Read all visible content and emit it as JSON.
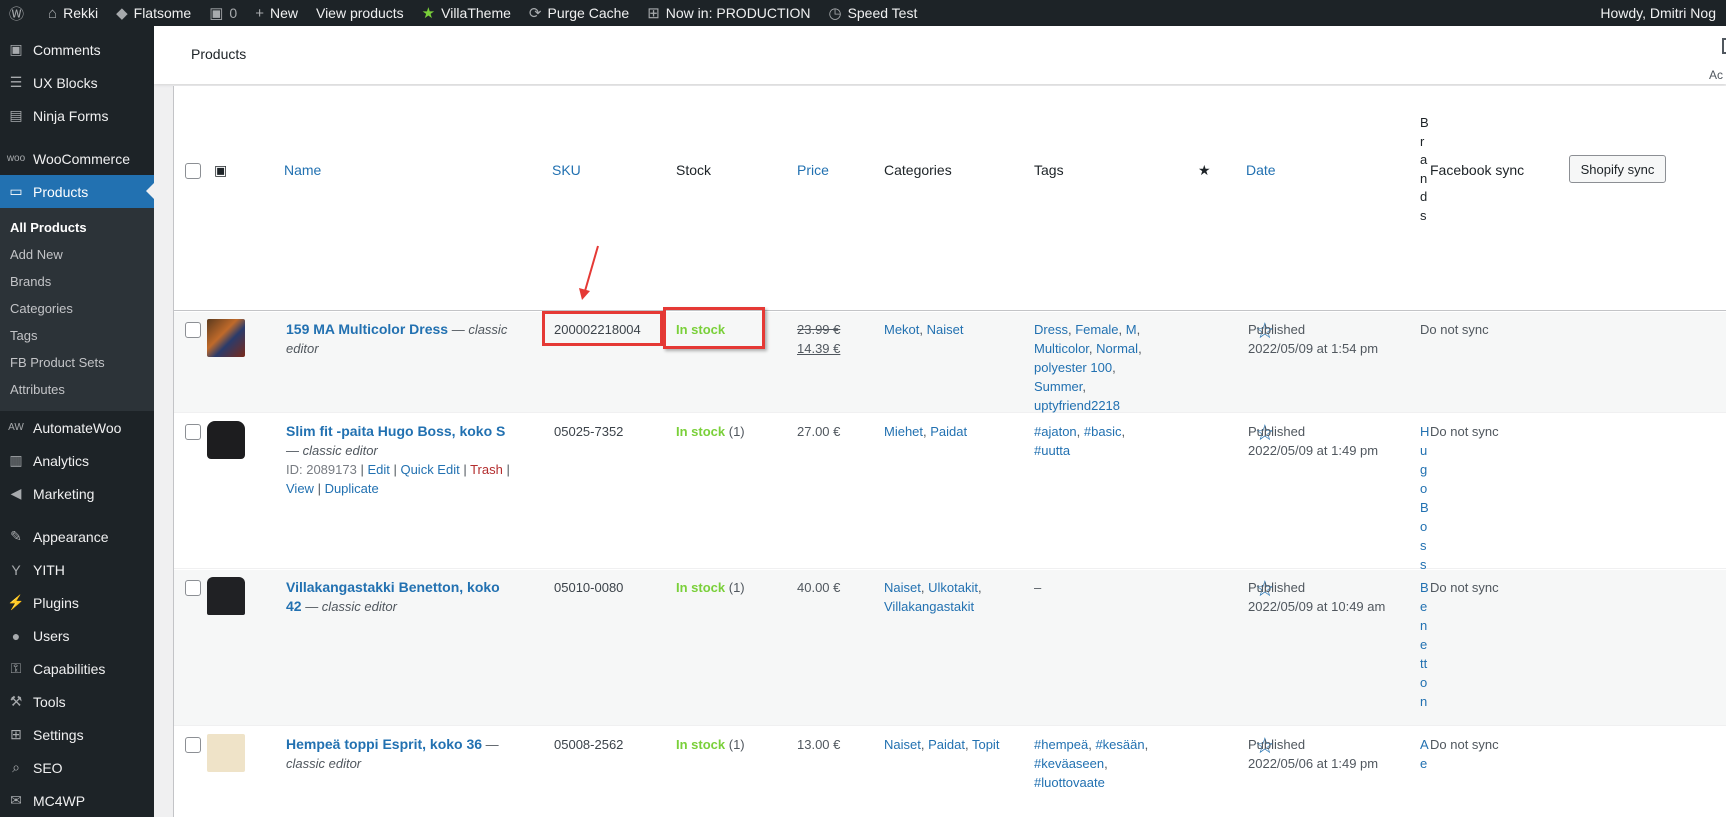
{
  "adminbar": {
    "items": [
      {
        "icon": "wordpress-icon",
        "label": ""
      },
      {
        "icon": "home-icon",
        "label": "Rekki"
      },
      {
        "icon": "flatsome-icon",
        "label": "Flatsome"
      },
      {
        "icon": "comment-icon",
        "label": "0"
      },
      {
        "icon": "plus-icon",
        "label": "New"
      },
      {
        "icon": "",
        "label": "View products"
      },
      {
        "icon": "villatheme-icon",
        "label": "VillaTheme"
      },
      {
        "icon": "refresh-icon",
        "label": "Purge Cache"
      },
      {
        "icon": "sitemap-icon",
        "label": "Now in: PRODUCTION"
      },
      {
        "icon": "speed-icon",
        "label": "Speed Test"
      }
    ],
    "greeting": "Howdy, Dmitri Nog"
  },
  "sidebar": {
    "top_items": [
      {
        "icon": "comments-icon",
        "label": "Comments"
      },
      {
        "icon": "ux-blocks-icon",
        "label": "UX Blocks"
      },
      {
        "icon": "ninja-forms-icon",
        "label": "Ninja Forms"
      }
    ],
    "commerce_items": [
      {
        "icon": "woocommerce-icon",
        "label": "WooCommerce"
      },
      {
        "icon": "products-icon",
        "label": "Products"
      }
    ],
    "submenu": [
      "All Products",
      "Add New",
      "Brands",
      "Categories",
      "Tags",
      "FB Product Sets",
      "Attributes"
    ],
    "bottom_items": [
      {
        "icon": "automatewoo-icon",
        "label": "AutomateWoo"
      },
      {
        "icon": "analytics-icon",
        "label": "Analytics"
      },
      {
        "icon": "marketing-icon",
        "label": "Marketing"
      }
    ],
    "bottom_items2": [
      {
        "icon": "appearance-icon",
        "label": "Appearance"
      },
      {
        "icon": "yith-icon",
        "label": "YITH"
      },
      {
        "icon": "plugins-icon",
        "label": "Plugins"
      },
      {
        "icon": "users-icon",
        "label": "Users"
      },
      {
        "icon": "capabilities-icon",
        "label": "Capabilities"
      },
      {
        "icon": "tools-icon",
        "label": "Tools"
      },
      {
        "icon": "settings-icon",
        "label": "Settings"
      },
      {
        "icon": "seo-icon",
        "label": "SEO"
      },
      {
        "icon": "mc4wp-icon",
        "label": "MC4WP"
      }
    ]
  },
  "header": {
    "title": "Products",
    "action": "Ac"
  },
  "table": {
    "headers": {
      "name": "Name",
      "sku": "SKU",
      "stock": "Stock",
      "price": "Price",
      "categories": "Categories",
      "tags": "Tags",
      "date": "Date",
      "brands": "Brands",
      "facebook": "Facebook sync",
      "shopify": "Shopify sync"
    },
    "rows": [
      {
        "name": "159 MA Multicolor Dress",
        "suffix": " — classic editor",
        "sku": "200002218004",
        "stock": "In stock",
        "stock_count": "",
        "price_old": "23.99 €",
        "price": "14.39 €",
        "categories": [
          "Mekot",
          "Naiset"
        ],
        "tags": [
          "Dress",
          "Female",
          "M",
          "Multicolor",
          "Normal",
          "polyester 100",
          "Summer",
          "uptyfriend2218"
        ],
        "date_status": "Published",
        "date": "2022/05/09 at 1:54 pm",
        "brand": "",
        "fb": "Do not sync"
      },
      {
        "name": "Slim fit -paita Hugo Boss, koko S",
        "suffix": " — classic editor",
        "id_label": "ID: 2089173",
        "actions": [
          "Edit",
          "Quick Edit",
          "Trash",
          "View",
          "Duplicate"
        ],
        "sku": "05025-7352",
        "stock": "In stock",
        "stock_count": "(1)",
        "price": "27.00 €",
        "categories": [
          "Miehet",
          "Paidat"
        ],
        "tags": [
          "#ajaton",
          "#basic",
          "#uutta"
        ],
        "date_status": "Published",
        "date": "2022/05/09 at 1:49 pm",
        "brand": "Hugo Boss",
        "fb": "Do not sync"
      },
      {
        "name": "Villakangastakki Benetton, koko 42",
        "suffix": " — classic editor",
        "sku": "05010-0080",
        "stock": "In stock",
        "stock_count": "(1)",
        "price": "40.00 €",
        "categories": [
          "Naiset",
          "Ulkotakit",
          "Villakangastakit"
        ],
        "tags": [
          "–"
        ],
        "date_status": "Published",
        "date": "2022/05/09 at 10:49 am",
        "brand": "Benetton",
        "fb": "Do not sync"
      },
      {
        "name": "Hempeä toppi Esprit, koko 36",
        "suffix": " — classic editor",
        "sku": "05008-2562",
        "stock": "In stock",
        "stock_count": "(1)",
        "price": "13.00 €",
        "categories": [
          "Naiset",
          "Paidat",
          "Topit"
        ],
        "tags": [
          "#hempeä",
          "#kesään",
          "#keväaseen",
          "#luottovaate"
        ],
        "date_status": "Published",
        "date": "2022/05/06 at 1:49 pm",
        "brand": "Ae",
        "fb": "Do not sync"
      }
    ]
  }
}
